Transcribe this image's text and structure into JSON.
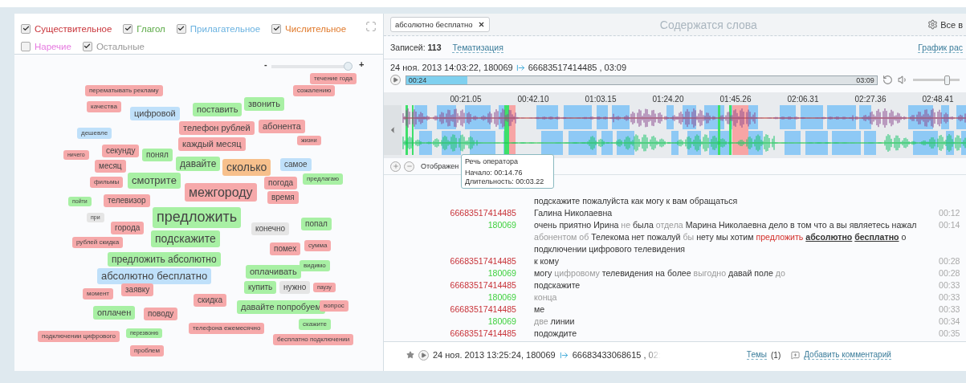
{
  "categories": [
    {
      "label": "Существительное",
      "checked": true,
      "color": "#c9353b"
    },
    {
      "label": "Глагол",
      "checked": true,
      "color": "#5aa945"
    },
    {
      "label": "Прилагательное",
      "checked": true,
      "color": "#6ab2e0"
    },
    {
      "label": "Числительное",
      "checked": true,
      "color": "#e07a2c"
    },
    {
      "label": "Наречие",
      "checked": false,
      "color": "#e67be0"
    },
    {
      "label": "Остальные",
      "checked": true,
      "color": "#999999"
    }
  ],
  "zoom_slider": {
    "minus": "-",
    "plus": "+",
    "level": 0.95
  },
  "word_cloud": [
    {
      "text": "течение года",
      "kind": "noun"
    },
    {
      "text": "перематывать рекламу",
      "kind": "noun"
    },
    {
      "text": "сожалению",
      "kind": "noun"
    },
    {
      "text": "качества",
      "kind": "noun"
    },
    {
      "text": "цифровой",
      "kind": "adjective"
    },
    {
      "text": "поставить",
      "kind": "verb"
    },
    {
      "text": "звонить",
      "kind": "verb"
    },
    {
      "text": "телефон рублей",
      "kind": "noun"
    },
    {
      "text": "абонента",
      "kind": "noun"
    },
    {
      "text": "дешевле",
      "kind": "adjective"
    },
    {
      "text": "каждый месяц",
      "kind": "noun"
    },
    {
      "text": "жизни",
      "kind": "noun"
    },
    {
      "text": "ничего",
      "kind": "noun"
    },
    {
      "text": "секунду",
      "kind": "noun"
    },
    {
      "text": "понял",
      "kind": "verb"
    },
    {
      "text": "месяц",
      "kind": "noun"
    },
    {
      "text": "давайте",
      "kind": "verb"
    },
    {
      "text": "сколько",
      "kind": "numeral"
    },
    {
      "text": "самое",
      "kind": "adjective"
    },
    {
      "text": "фильмы",
      "kind": "noun"
    },
    {
      "text": "смотрите",
      "kind": "verb"
    },
    {
      "text": "межгороду",
      "kind": "noun"
    },
    {
      "text": "погода",
      "kind": "noun"
    },
    {
      "text": "предлагаю",
      "kind": "verb"
    },
    {
      "text": "пойти",
      "kind": "verb"
    },
    {
      "text": "телевизор",
      "kind": "noun"
    },
    {
      "text": "время",
      "kind": "noun"
    },
    {
      "text": "при",
      "kind": "other"
    },
    {
      "text": "предложить",
      "kind": "verb"
    },
    {
      "text": "города",
      "kind": "noun"
    },
    {
      "text": "конечно",
      "kind": "other"
    },
    {
      "text": "попал",
      "kind": "verb"
    },
    {
      "text": "рублей скидка",
      "kind": "noun"
    },
    {
      "text": "подскажите",
      "kind": "verb"
    },
    {
      "text": "помех",
      "kind": "noun"
    },
    {
      "text": "сумма",
      "kind": "noun"
    },
    {
      "text": "предложить абсолютно",
      "kind": "verb"
    },
    {
      "text": "оплачивать",
      "kind": "verb"
    },
    {
      "text": "видимо",
      "kind": "verb"
    },
    {
      "text": "абсолютно бесплатно",
      "kind": "adjective"
    },
    {
      "text": "купить",
      "kind": "verb"
    },
    {
      "text": "нужно",
      "kind": "other"
    },
    {
      "text": "паузу",
      "kind": "noun"
    },
    {
      "text": "момент",
      "kind": "noun"
    },
    {
      "text": "заявку",
      "kind": "noun"
    },
    {
      "text": "скидка",
      "kind": "noun"
    },
    {
      "text": "давайте попробуем",
      "kind": "verb"
    },
    {
      "text": "вопрос",
      "kind": "noun"
    },
    {
      "text": "оплачен",
      "kind": "verb"
    },
    {
      "text": "поводу",
      "kind": "noun"
    },
    {
      "text": "скажите",
      "kind": "verb"
    },
    {
      "text": "телефона ежемесячно",
      "kind": "noun"
    },
    {
      "text": "подключении цифрового",
      "kind": "noun"
    },
    {
      "text": "перезвоню",
      "kind": "verb"
    },
    {
      "text": "бесплатно подключении",
      "kind": "noun"
    },
    {
      "text": "проблем",
      "kind": "noun"
    }
  ],
  "filter": {
    "chip": "абсолютно бесплатно",
    "placeholder": "Содержатся слова",
    "settings_label": "Все в"
  },
  "stats": {
    "label": "Записей:",
    "count": "113",
    "link": "Тематизация",
    "chart_link": "График рас"
  },
  "record": {
    "caller": "24 ноя. 2013 14:03:22, 180069",
    "callee": "66683517414485 , 03:09"
  },
  "player": {
    "elapsed": "00:24",
    "total": "03:09",
    "level": 0.13,
    "volume": {
      "level": 0.75
    }
  },
  "waveform": {
    "ticks": [
      "00:21.05",
      "00:42.10",
      "01:03.15",
      "01:24.20",
      "01:45.26",
      "02:06.31",
      "02:27.36",
      "02:48.41"
    ]
  },
  "view_controls": {
    "label": "Отображен"
  },
  "tooltip": {
    "title": "Речь оператора",
    "start": "Начало: 00:14.76",
    "duration": "Длительность: 00:03.22"
  },
  "transcript": [
    {
      "kind": "continuation",
      "words": [
        {
          "text": "подскажите пожалуйста как могу к вам обращаться",
          "kind": "normal"
        }
      ]
    },
    {
      "kind": "turn",
      "speaker": "66683517414485",
      "color": "#c8343a",
      "time": "00:12",
      "words": [
        {
          "text": "Галина Николаевна",
          "kind": "normal"
        }
      ]
    },
    {
      "kind": "turn",
      "speaker": "180069",
      "color": "#3fd13f",
      "time": "00:14",
      "words": [
        {
          "text": "очень приятно Ирина",
          "kind": "normal"
        },
        {
          "text": "не",
          "kind": "dim"
        },
        {
          "text": "была",
          "kind": "normal"
        },
        {
          "text": "отдела",
          "kind": "dim"
        },
        {
          "text": "Марина Николаевна дело в том что а вы являетесь нажал",
          "kind": "normal"
        },
        {
          "text": "абонентом об",
          "kind": "dim"
        },
        {
          "text": "Телекома нет пожалуй",
          "kind": "normal"
        },
        {
          "text": "бы",
          "kind": "dim"
        },
        {
          "text": "нету мы хотим",
          "kind": "normal"
        },
        {
          "text": "предложить",
          "kind": "keyword"
        },
        {
          "text": "абсолютно",
          "kind": "match"
        },
        {
          "text": "бесплатно",
          "kind": "match"
        },
        {
          "text": "о подключении цифрового телевидения",
          "kind": "normal"
        }
      ]
    },
    {
      "kind": "turn",
      "speaker": "66683517414485",
      "color": "#c8343a",
      "time": "00:28",
      "words": [
        {
          "text": "к кому",
          "kind": "normal"
        }
      ]
    },
    {
      "kind": "turn",
      "speaker": "180069",
      "color": "#3fd13f",
      "time": "00:28",
      "words": [
        {
          "text": "могу",
          "kind": "normal"
        },
        {
          "text": "цифровому",
          "kind": "dim"
        },
        {
          "text": "телевидения на более",
          "kind": "normal"
        },
        {
          "text": "выгодно",
          "kind": "dim"
        },
        {
          "text": "давай поле",
          "kind": "normal"
        },
        {
          "text": "до",
          "kind": "dim"
        }
      ]
    },
    {
      "kind": "turn",
      "speaker": "66683517414485",
      "color": "#c8343a",
      "time": "00:33",
      "words": [
        {
          "text": "подскажите",
          "kind": "normal"
        }
      ]
    },
    {
      "kind": "turn",
      "speaker": "180069",
      "color": "#3fd13f",
      "time": "00:33",
      "words": [
        {
          "text": "конца",
          "kind": "dim"
        }
      ]
    },
    {
      "kind": "turn",
      "speaker": "66683517414485",
      "color": "#c8343a",
      "time": "00:33",
      "words": [
        {
          "text": "ме",
          "kind": "normal"
        }
      ]
    },
    {
      "kind": "turn",
      "speaker": "180069",
      "color": "#3fd13f",
      "time": "00:34",
      "words": [
        {
          "text": "две",
          "kind": "dim"
        },
        {
          "text": "линии",
          "kind": "normal"
        }
      ]
    },
    {
      "kind": "turn",
      "speaker": "66683517414485",
      "color": "#c8343a",
      "time": "00:35",
      "words": [
        {
          "text": "подождите",
          "kind": "normal"
        }
      ]
    }
  ],
  "next_record": {
    "caller": "24 ноя. 2013 13:25:24, 180069",
    "callee": "66683433068615 , 02:",
    "topics": "Темы",
    "topics_count": "(1)",
    "comment": "Добавить комментарий"
  }
}
